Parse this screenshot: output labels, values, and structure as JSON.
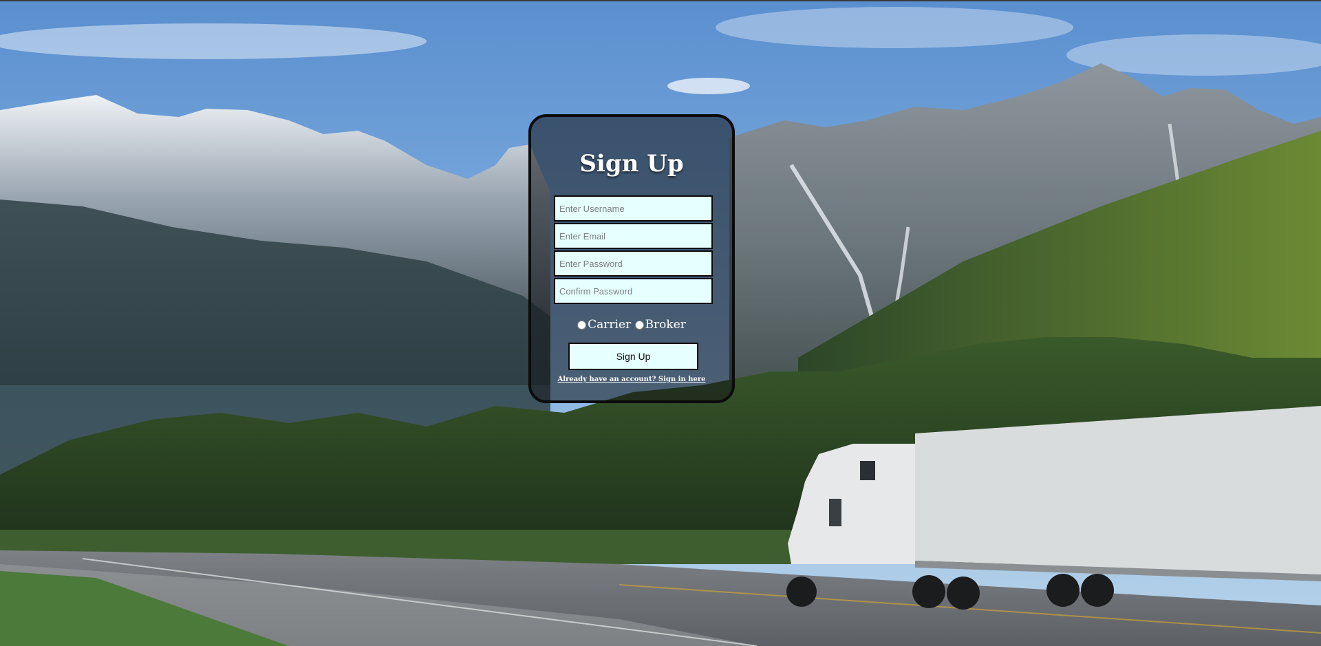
{
  "form": {
    "title": "Sign Up",
    "username_placeholder": "Enter Username",
    "email_placeholder": "Enter Email",
    "password_placeholder": "Enter Password",
    "confirm_placeholder": "Confirm Password",
    "role_options": [
      "Carrier",
      "Broker"
    ],
    "submit_label": "Sign Up",
    "signin_link": "Already have an account? Sign in here"
  },
  "colors": {
    "field_bg": "#e6ffff",
    "card_border": "#0b0b0b",
    "text_light": "#ffffff"
  },
  "icons": {
    "radio": "radio-circle"
  }
}
